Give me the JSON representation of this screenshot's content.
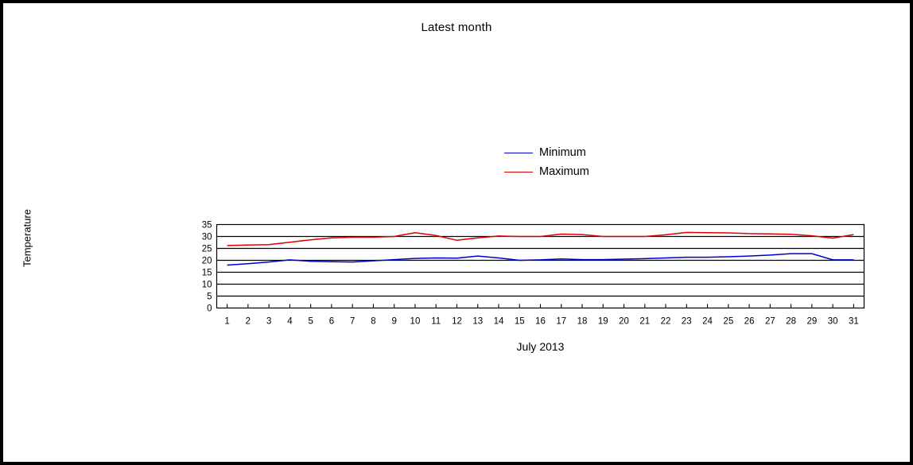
{
  "chart_data": {
    "type": "line",
    "title": "Latest month",
    "xlabel": "July 2013",
    "ylabel": "Temperature",
    "grid": true,
    "legend_position": "above-plot-center",
    "x": [
      1,
      2,
      3,
      4,
      5,
      6,
      7,
      8,
      9,
      10,
      11,
      12,
      13,
      14,
      15,
      16,
      17,
      18,
      19,
      20,
      21,
      22,
      23,
      24,
      25,
      26,
      27,
      28,
      29,
      30,
      31
    ],
    "categories": [
      "1",
      "2",
      "3",
      "4",
      "5",
      "6",
      "7",
      "8",
      "9",
      "10",
      "11",
      "12",
      "13",
      "14",
      "15",
      "16",
      "17",
      "18",
      "19",
      "20",
      "21",
      "22",
      "23",
      "24",
      "25",
      "26",
      "27",
      "28",
      "29",
      "30",
      "31"
    ],
    "xlim": [
      0.5,
      31.5
    ],
    "ylim": [
      0,
      35
    ],
    "yticks": [
      0,
      5,
      10,
      15,
      20,
      25,
      30,
      35
    ],
    "ytick_labels": [
      "0",
      "5",
      "10",
      "15",
      "20",
      "25",
      "30",
      "35"
    ],
    "series": [
      {
        "name": "Minimum",
        "color": "#0000cc",
        "values": [
          18.0,
          18.6,
          19.3,
          20.2,
          19.6,
          19.4,
          19.3,
          19.8,
          20.3,
          20.8,
          21.0,
          20.9,
          21.8,
          21.0,
          20.0,
          20.2,
          20.6,
          20.3,
          20.3,
          20.5,
          20.7,
          21.0,
          21.3,
          21.3,
          21.5,
          21.8,
          22.2,
          22.8,
          22.8,
          20.2,
          20.2
        ]
      },
      {
        "name": "Maximum",
        "color": "#dd0000",
        "values": [
          26.2,
          26.4,
          26.6,
          27.6,
          28.6,
          29.4,
          29.7,
          29.7,
          30.0,
          31.6,
          30.4,
          28.4,
          29.4,
          30.2,
          30.0,
          30.0,
          31.0,
          30.8,
          30.0,
          30.0,
          30.0,
          30.7,
          31.7,
          31.6,
          31.5,
          31.2,
          31.1,
          30.9,
          30.3,
          29.3,
          30.8
        ]
      }
    ]
  },
  "legend": {
    "items": [
      {
        "label": "Minimum",
        "color": "#0000cc"
      },
      {
        "label": "Maximum",
        "color": "#dd0000"
      }
    ]
  },
  "colors": {
    "minimum": "#0000cc",
    "maximum": "#dd0000",
    "axis": "#000000",
    "background": "#ffffff",
    "border": "#000000"
  }
}
